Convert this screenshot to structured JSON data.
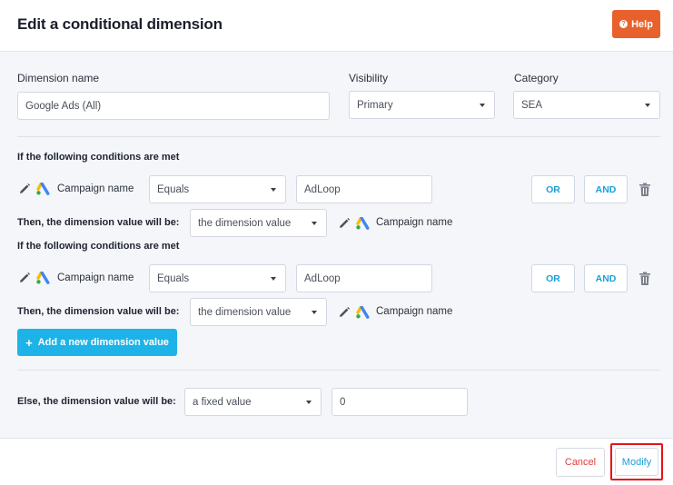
{
  "header": {
    "title": "Edit a conditional dimension",
    "help_label": "Help"
  },
  "form": {
    "dimension_name_label": "Dimension name",
    "dimension_name_value": "Google Ads (All)",
    "visibility_label": "Visibility",
    "visibility_value": "Primary",
    "category_label": "Category",
    "category_value": "SEA"
  },
  "rules": [
    {
      "conditions_heading": "If the following conditions are met",
      "field_label": "Campaign name",
      "operator": "Equals",
      "value": "AdLoop",
      "or_label": "OR",
      "and_label": "AND",
      "then_label": "Then, the dimension value will be:",
      "then_select": "the dimension value",
      "then_field_label": "Campaign name"
    },
    {
      "conditions_heading": "If the following conditions are met",
      "field_label": "Campaign name",
      "operator": "Equals",
      "value": "AdLoop",
      "or_label": "OR",
      "and_label": "AND",
      "then_label": "Then, the dimension value will be:",
      "then_select": "the dimension value",
      "then_field_label": "Campaign name"
    }
  ],
  "add_button_label": "Add a new dimension value",
  "else": {
    "label": "Else, the dimension value will be:",
    "select_value": "a fixed value",
    "input_value": "0"
  },
  "footer": {
    "cancel_label": "Cancel",
    "modify_label": "Modify"
  },
  "colors": {
    "help": "#e8612c",
    "primary": "#1eb3e8",
    "link": "#1ba0d8",
    "danger": "#e43b3b",
    "highlight": "#e8121b"
  },
  "icons": {
    "pencil": "pencil-icon",
    "google_ads": "google-ads-icon",
    "trash": "trash-icon",
    "help": "question-icon",
    "plus": "plus-icon"
  }
}
